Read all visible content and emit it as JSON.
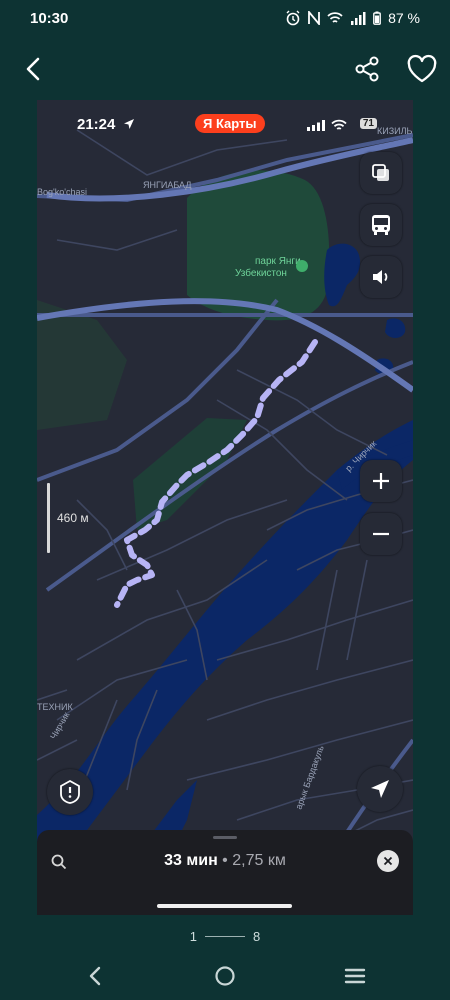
{
  "status_bar": {
    "time": "10:30",
    "battery": "87 %",
    "icons": [
      "alarm-icon",
      "nfc-icon",
      "wifi-icon",
      "signal-icon",
      "battery-icon"
    ]
  },
  "top_bar": {
    "icons": [
      "back-arrow-icon",
      "share-icon",
      "heart-icon"
    ]
  },
  "screenshot": {
    "status": {
      "time": "21:24",
      "brand": "Карты",
      "brand_letter": "Я",
      "battery": "71"
    },
    "map_labels": {
      "road_left": "Bog'ko'chasi",
      "district_top": "ЯНГИАБАД",
      "district_right": "КИЗИЛЬБ",
      "park_line1": "парк Янги",
      "park_line2": "Узбекистон",
      "river_right": "р. Чирчик",
      "river_left": "Чирчик",
      "district_left": "ТЕХНИК",
      "canal": "арык Бардакуль"
    },
    "scale_label": "460 м",
    "panel": {
      "duration": "33 мин",
      "separator": " • ",
      "distance": "2,75 км"
    },
    "colors": {
      "route": "#b7b4f5",
      "water": "#0d2a66",
      "park": "#1f4a3a",
      "roads": "#5a6ea8",
      "background": "#262a37"
    }
  },
  "pager": {
    "current": "1",
    "total": "8"
  },
  "nav_bar": {
    "icons": [
      "nav-back-icon",
      "nav-home-icon",
      "nav-recents-icon"
    ]
  }
}
